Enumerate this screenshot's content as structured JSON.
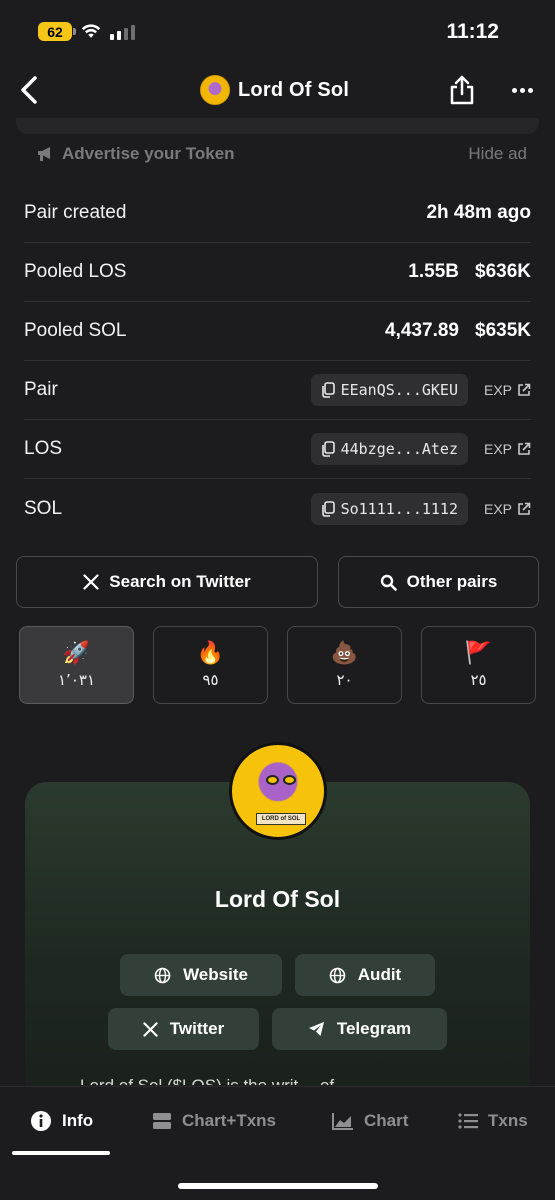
{
  "status_bar": {
    "battery": "62",
    "time": "11:12"
  },
  "nav": {
    "title": "Lord Of Sol",
    "icons": [
      "chevron-left-icon",
      "share-icon",
      "more-icon"
    ]
  },
  "ad": {
    "advertise_label": "Advertise your Token",
    "hide_label": "Hide ad"
  },
  "info": {
    "pair_created_label": "Pair created",
    "pair_created_value": "2h 48m ago",
    "pooled_los_label": "Pooled LOS",
    "pooled_los_amount": "1.55B",
    "pooled_los_usd": "$636K",
    "pooled_sol_label": "Pooled SOL",
    "pooled_sol_amount": "4,437.89",
    "pooled_sol_usd": "$635K",
    "addresses": [
      {
        "label": "Pair",
        "address": "EEanQS...GKEU",
        "exp": "EXP"
      },
      {
        "label": "LOS",
        "address": "44bzge...Atez",
        "exp": "EXP"
      },
      {
        "label": "SOL",
        "address": "So1111...1112",
        "exp": "EXP"
      }
    ]
  },
  "actions": {
    "twitter_search": "Search on Twitter",
    "other_pairs": "Other pairs"
  },
  "reactions": [
    {
      "emoji": "🚀",
      "count": "١٬٠٣١",
      "active": true
    },
    {
      "emoji": "🔥",
      "count": "٩٥",
      "active": false
    },
    {
      "emoji": "💩",
      "count": "٢٠",
      "active": false
    },
    {
      "emoji": "🚩",
      "count": "٢٥",
      "active": false
    }
  ],
  "profile": {
    "name": "Lord Of Sol",
    "avatar_banner": "LORD of SOL",
    "links": {
      "website": "Website",
      "audit": "Audit",
      "twitter": "Twitter",
      "telegram": "Telegram"
    },
    "description_partial": "Lord of Sol ($LOS) is the writ… of"
  },
  "tabs": [
    {
      "label": "Info",
      "icon": "info-icon",
      "active": true
    },
    {
      "label": "Chart+Txns",
      "icon": "chart-txns-icon",
      "active": false
    },
    {
      "label": "Chart",
      "icon": "area-chart-icon",
      "active": false
    },
    {
      "label": "Txns",
      "icon": "list-icon",
      "active": false
    }
  ]
}
